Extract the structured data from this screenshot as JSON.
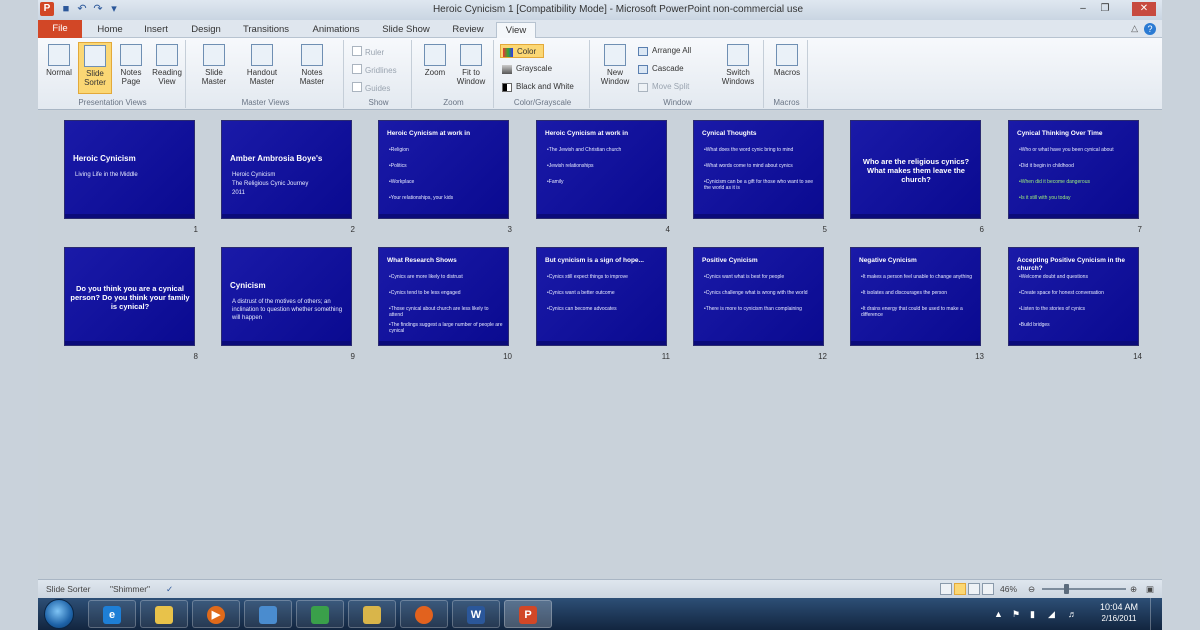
{
  "window": {
    "title": "Heroic Cynicism 1 [Compatibility Mode] - Microsoft PowerPoint non-commercial use"
  },
  "tabs": [
    "File",
    "Home",
    "Insert",
    "Design",
    "Transitions",
    "Animations",
    "Slide Show",
    "Review",
    "View"
  ],
  "ribbon": {
    "presentation_views": {
      "label": "Presentation Views",
      "buttons": [
        "Normal",
        "Slide Sorter",
        "Notes Page",
        "Reading View"
      ]
    },
    "master_views": {
      "label": "Master Views",
      "buttons": [
        "Slide Master",
        "Handout Master",
        "Notes Master"
      ]
    },
    "show": {
      "label": "Show",
      "checks": [
        "Ruler",
        "Gridlines",
        "Guides"
      ]
    },
    "zoom": {
      "label": "Zoom",
      "buttons": [
        "Zoom",
        "Fit to Window"
      ]
    },
    "color_grayscale": {
      "label": "Color/Grayscale",
      "buttons": [
        "Color",
        "Grayscale",
        "Black and White"
      ]
    },
    "window": {
      "label": "Window",
      "new_window": "New Window",
      "small": [
        "Arrange All",
        "Cascade",
        "Move Split"
      ],
      "switch": "Switch Windows"
    },
    "macros": {
      "label": "Macros",
      "button": "Macros"
    }
  },
  "slides": [
    {
      "num": "1",
      "title": "Heroic Cynicism",
      "sub": [
        "Living Life in the Middle"
      ]
    },
    {
      "num": "2",
      "title": "Amber Ambrosia Boye's",
      "sub": [
        "Heroic Cynicism",
        "The Religious Cynic Journey",
        "2011"
      ]
    },
    {
      "num": "3",
      "title": "Heroic Cynicism at work in",
      "bullets": [
        "Religion",
        "Politics",
        "Workplace",
        "Your relationships, your kids"
      ]
    },
    {
      "num": "4",
      "title": "Heroic Cynicism at work in",
      "bullets": [
        "The Jewish and Christian church",
        "Jewish relationships",
        "Family"
      ]
    },
    {
      "num": "5",
      "title": "Cynical Thoughts",
      "bullets": [
        "What does the word cynic bring to mind",
        "What words come to mind about cynics",
        "Cynicism can be a gift for those who want to see the world as it is"
      ]
    },
    {
      "num": "6",
      "title": "Who are the religious cynics? What makes them leave the church?"
    },
    {
      "num": "7",
      "title": "Cynical Thinking Over Time",
      "bullets": [
        "Who or what have you been cynical about",
        "Did it begin in childhood",
        "When did it become dangerous",
        "Is it still with you today"
      ]
    },
    {
      "num": "8",
      "title": "Do you think you are a cynical person? Do you think your family is cynical?"
    },
    {
      "num": "9",
      "title": "Cynicism",
      "sub": [
        "A distrust of the motives of others; an inclination to question whether something will happen"
      ]
    },
    {
      "num": "10",
      "title": "What Research Shows",
      "bullets": [
        "Cynics are more likely to distrust",
        "Cynics tend to be less engaged",
        "Those cynical about church are less likely to attend",
        "The findings suggest a large number of people are cynical"
      ]
    },
    {
      "num": "11",
      "title": "But cynicism is a sign of hope...",
      "bullets": [
        "Cynics still expect things to improve",
        "Cynics want a better outcome",
        "Cynics can become advocates"
      ]
    },
    {
      "num": "12",
      "title": "Positive Cynicism",
      "bullets": [
        "Cynics want what is best for people",
        "Cynics challenge what is wrong with the world",
        "There is more to cynicism than complaining"
      ]
    },
    {
      "num": "13",
      "title": "Negative Cynicism",
      "bullets": [
        "It makes a person feel unable to change anything",
        "It isolates and discourages the person",
        "It drains energy that could be used to make a difference"
      ]
    },
    {
      "num": "14",
      "title": "Accepting Positive Cynicism in the church?",
      "bullets": [
        "Welcome doubt and questions",
        "Create space for honest conversation",
        "Listen to the stories of cynics",
        "Build bridges"
      ]
    }
  ],
  "status": {
    "view_name": "Slide Sorter",
    "theme": "\"Shimmer\"",
    "zoom": "46%"
  },
  "taskbar": {
    "time": "10:04 AM",
    "date": "2/16/2011"
  },
  "colors": {
    "file_tab": "#d24726",
    "slide_bg": "#1a1aa8",
    "active_button": "#fbd774"
  }
}
